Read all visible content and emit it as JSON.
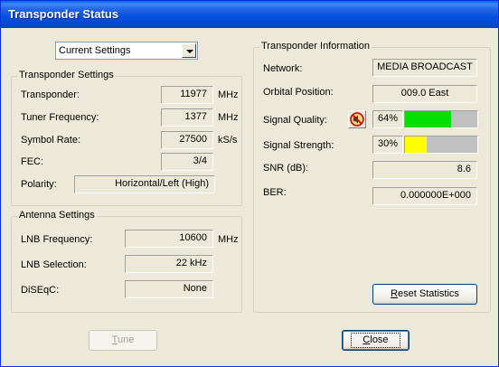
{
  "window": {
    "title": "Transponder Status"
  },
  "settings_select": {
    "value": "Current Settings"
  },
  "transponder_settings": {
    "legend": "Transponder Settings",
    "transponder": {
      "label": "Transponder:",
      "value": "11977",
      "unit": "MHz"
    },
    "tuner_frequency": {
      "label": "Tuner Frequency:",
      "value": "1377",
      "unit": "MHz"
    },
    "symbol_rate": {
      "label": "Symbol Rate:",
      "value": "27500",
      "unit": "kS/s"
    },
    "fec": {
      "label": "FEC:",
      "value": "3/4"
    },
    "polarity": {
      "label": "Polarity:",
      "value": "Horizontal/Left (High)"
    }
  },
  "antenna_settings": {
    "legend": "Antenna Settings",
    "lnb_frequency": {
      "label": "LNB Frequency:",
      "value": "10600",
      "unit": "MHz"
    },
    "lnb_selection": {
      "label": "LNB Selection:",
      "value": "22 kHz"
    },
    "diseqc": {
      "label": "DiSEqC:",
      "value": "None"
    }
  },
  "transponder_info": {
    "legend": "Transponder Information",
    "network": {
      "label": "Network:",
      "value": "MEDIA BROADCAST"
    },
    "orbital_position": {
      "label": "Orbital Position:",
      "value": "009.0 East"
    },
    "signal_quality": {
      "label": "Signal Quality:",
      "value": "64%",
      "level": 0.64,
      "color": "#00E000"
    },
    "signal_strength": {
      "label": "Signal Strength:",
      "value": "30%",
      "level": 0.3,
      "color": "#FFFF00"
    },
    "snr": {
      "label": "SNR (dB):",
      "value": "8.6"
    },
    "ber": {
      "label": "BER:",
      "value": "0.000000E+000"
    },
    "mute_icon": "speaker-muted-icon"
  },
  "buttons": {
    "reset_statistics": {
      "mnemonic": "R",
      "rest": "eset Statistics"
    },
    "tune": {
      "mnemonic": "T",
      "rest": "une"
    },
    "close": {
      "mnemonic": "C",
      "rest": "lose"
    }
  }
}
